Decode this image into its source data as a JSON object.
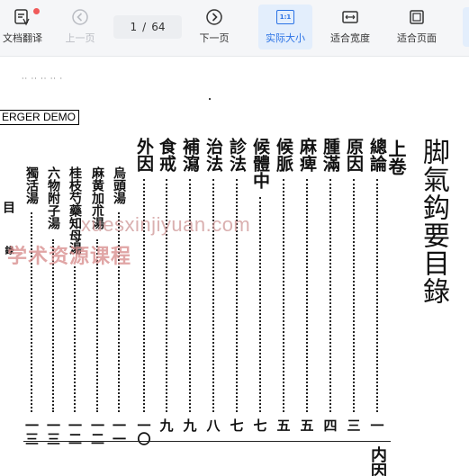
{
  "toolbar": {
    "doc_translate_label": "文档翻译",
    "prev_page_label": "上一页",
    "current_page": "1",
    "page_separator": "/",
    "total_pages": "64",
    "next_page_label": "下一页",
    "actual_size_label": "实际大小",
    "actual_size_icon_text": "1:1",
    "fit_width_label": "适合宽度",
    "fit_page_label": "适合页面"
  },
  "document": {
    "banner": "ERGER DEMO",
    "title": "脚氣鈎要目錄",
    "volume": "上卷",
    "entries": [
      {
        "text": "總論",
        "page": "一"
      },
      {
        "text": "原因",
        "page": "三"
      },
      {
        "text": "腫滿",
        "page": "四"
      },
      {
        "text": "麻痺",
        "page": "五"
      },
      {
        "text": "候脈",
        "page": "五"
      },
      {
        "text": "候體中",
        "page": "七"
      },
      {
        "text": "診法",
        "page": "七"
      },
      {
        "text": "治法",
        "page": "八"
      },
      {
        "text": "補瀉",
        "page": "九"
      },
      {
        "text": "食戒",
        "page": "九"
      },
      {
        "text": "外因",
        "page": "一〇"
      },
      {
        "text": "烏頭湯",
        "page": "一一"
      },
      {
        "text": "麻黄加朮湯",
        "page": "一二"
      },
      {
        "text": "桂枝芍藥知母湯",
        "page": "一二"
      },
      {
        "text": "六物附子湯",
        "page": "一三"
      },
      {
        "text": "獨活湯",
        "page": "一三"
      }
    ],
    "partial_right_text": "内因",
    "partial_left_text": "目",
    "partial_left_sub": "錄"
  },
  "watermark": {
    "line1": "xuesxinjiyuan.com",
    "line2": "学术资源课程"
  },
  "colors": {
    "accent": "#2a72e5",
    "notification_dot": "#f05a5a",
    "watermark": "#d08c8c"
  }
}
